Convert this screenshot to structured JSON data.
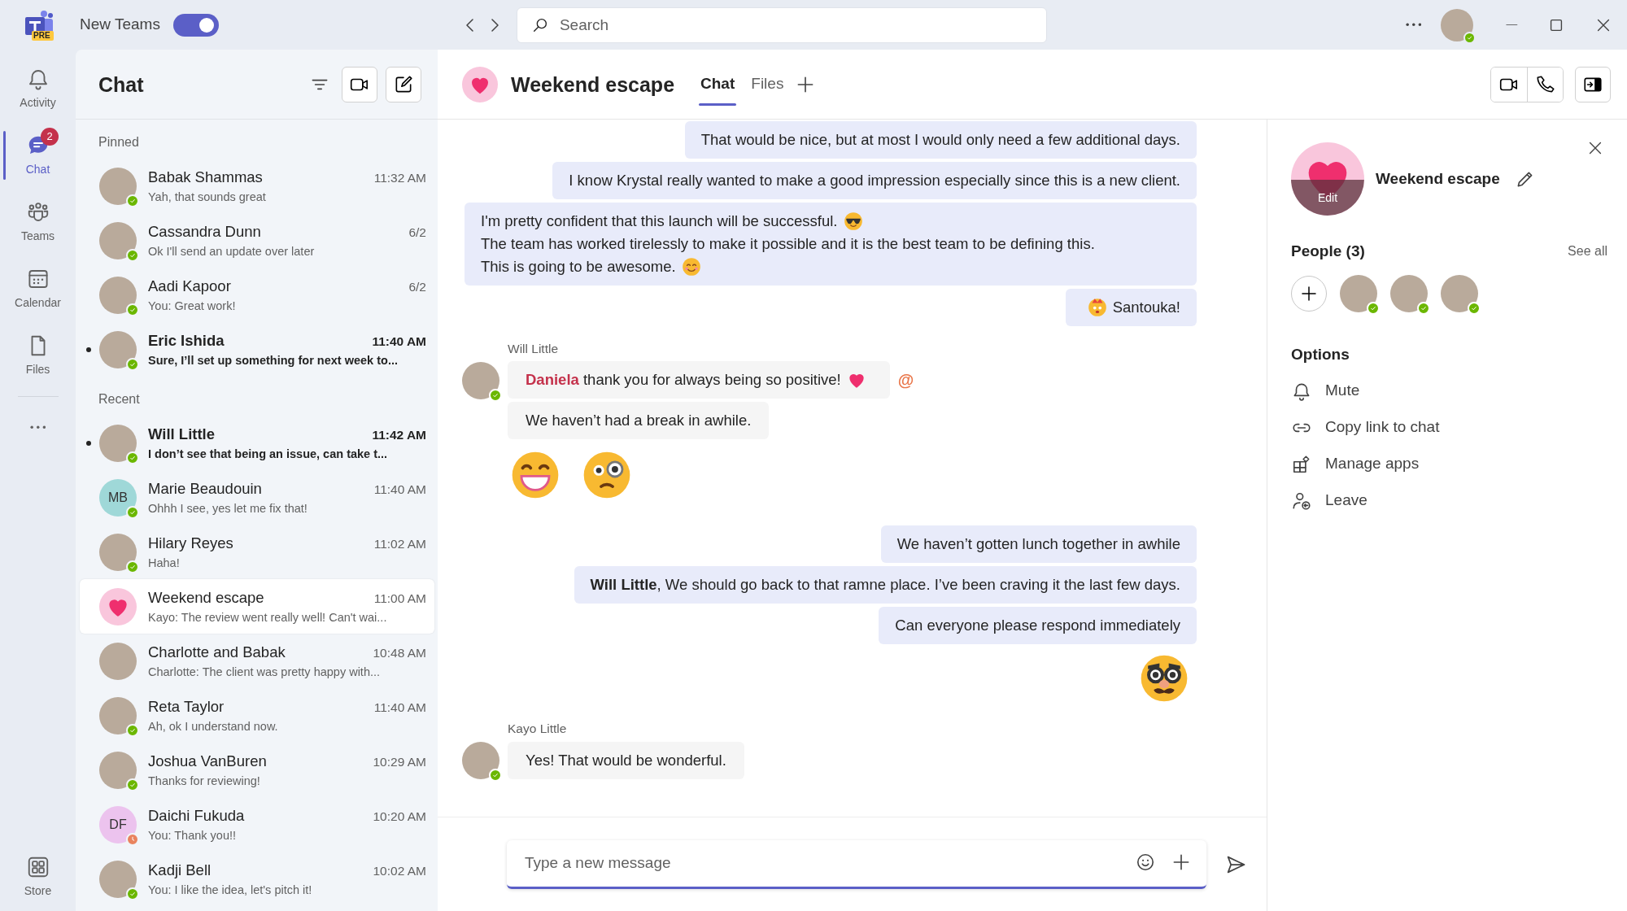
{
  "title_bar": {
    "logo_badge": "PRE",
    "toggle_label": "New Teams",
    "toggle_on": true,
    "search_placeholder": "Search"
  },
  "rail": {
    "items": [
      {
        "kind": "bell",
        "label": "Activity",
        "selected": false
      },
      {
        "kind": "chat",
        "label": "Chat",
        "badge": "2",
        "selected": true
      },
      {
        "kind": "teams",
        "label": "Teams",
        "selected": false
      },
      {
        "kind": "calendar",
        "label": "Calendar",
        "selected": false
      },
      {
        "kind": "files",
        "label": "Files",
        "selected": false
      }
    ],
    "store_label": "Store"
  },
  "chat_list": {
    "title": "Chat",
    "sections": [
      {
        "label": "Pinned",
        "items": [
          {
            "kind": "photo",
            "name": "Babak Shammas",
            "time": "11:32 AM",
            "preview": "Yah, that sounds great",
            "presence": {
              "kind": "available"
            },
            "unread": false,
            "selected": false
          },
          {
            "kind": "photo",
            "name": "Cassandra Dunn",
            "time": "6/2",
            "preview": "Ok I'll send an update over later",
            "presence": {
              "kind": "available"
            },
            "unread": false,
            "selected": false
          },
          {
            "kind": "photo",
            "name": "Aadi Kapoor",
            "time": "6/2",
            "preview": "You: Great work!",
            "presence": {
              "kind": "available"
            },
            "unread": false,
            "selected": false
          },
          {
            "kind": "photo",
            "name": "Eric Ishida",
            "time": "11:40 AM",
            "preview": "Sure, I’ll set up something for next week to...",
            "presence": {
              "kind": "available"
            },
            "unread": true,
            "selected": false
          }
        ]
      },
      {
        "label": "Recent",
        "items": [
          {
            "kind": "photo",
            "name": "Will Little",
            "time": "11:42 AM",
            "preview": "I don’t see that being an issue, can take t...",
            "presence": {
              "kind": "available"
            },
            "unread": true,
            "selected": false
          },
          {
            "kind": "initials",
            "initials": "MB",
            "color": "#9fd8d8",
            "name": "Marie Beaudouin",
            "time": "11:40 AM",
            "preview": "Ohhh I see, yes let me fix that!",
            "presence": {
              "kind": "available"
            },
            "unread": false,
            "selected": false
          },
          {
            "kind": "photo",
            "name": "Hilary Reyes",
            "time": "11:02 AM",
            "preview": "Haha!",
            "presence": {
              "kind": "available"
            },
            "unread": false,
            "selected": false
          },
          {
            "kind": "heart",
            "name": "Weekend escape",
            "time": "11:00 AM",
            "preview": "Kayo: The review went really well! Can't wai...",
            "unread": false,
            "selected": true
          },
          {
            "kind": "photo",
            "name": "Charlotte and Babak",
            "time": "10:48 AM",
            "preview": "Charlotte: The client was pretty happy with...",
            "unread": false,
            "selected": false
          },
          {
            "kind": "photo",
            "name": "Reta Taylor",
            "time": "11:40 AM",
            "preview": "Ah, ok I understand now.",
            "presence": {
              "kind": "available"
            },
            "unread": false,
            "selected": false
          },
          {
            "kind": "photo",
            "name": "Joshua VanBuren",
            "time": "10:29 AM",
            "preview": "Thanks for reviewing!",
            "presence": {
              "kind": "available"
            },
            "unread": false,
            "selected": false
          },
          {
            "kind": "initials",
            "initials": "DF",
            "color": "#ecc3ee",
            "name": "Daichi Fukuda",
            "time": "10:20 AM",
            "preview": "You: Thank you!!",
            "presence": {
              "kind": "away"
            },
            "unread": false,
            "selected": false
          },
          {
            "kind": "photo",
            "name": "Kadji Bell",
            "time": "10:02 AM",
            "preview": "You: I like the idea, let's pitch it!",
            "presence": {
              "kind": "available"
            },
            "unread": false,
            "selected": false
          }
        ]
      }
    ]
  },
  "conversation": {
    "title": "Weekend escape",
    "tabs": [
      {
        "label": "Chat",
        "selected": true
      },
      {
        "label": "Files",
        "selected": false
      }
    ],
    "messages": [
      {
        "kind": "sent",
        "segments": [
          {
            "kind": "text",
            "text": "That would be nice, but at most I would only need a few additional days."
          }
        ]
      },
      {
        "kind": "sent",
        "segments": [
          {
            "kind": "text",
            "text": "I know Krystal really wanted to make a good impression especially since this is a new client."
          }
        ]
      },
      {
        "kind": "sent",
        "segments": [
          {
            "kind": "text",
            "text": "I'm pretty confident that this launch will be successful."
          },
          {
            "kind": "cool"
          },
          {
            "kind": "text",
            "text": "The team has worked tirelessly to make it possible and it is the best team to be defining this."
          },
          {
            "kind": "text",
            "text": "This is going to be awesome."
          },
          {
            "kind": "smile"
          }
        ]
      },
      {
        "kind": "sent",
        "segments": [
          {
            "kind": "party"
          },
          {
            "kind": "text",
            "text": "Santouka!"
          }
        ]
      },
      {
        "kind": "received",
        "sender": "Will Little",
        "presence": {
          "kind": "available"
        },
        "bubbles": [
          {
            "segments": [
              {
                "kind": "text",
                "text": "**Daniela** thank you for always being so positive!"
              },
              {
                "kind": "heart"
              }
            ],
            "mention": "@"
          },
          {
            "segments": [
              {
                "kind": "text",
                "text": "We haven’t had a break in awhile."
              }
            ]
          }
        ],
        "stickers": [
          {
            "kind": "grin"
          },
          {
            "kind": "monocle"
          }
        ]
      },
      {
        "kind": "sent",
        "segments": [
          {
            "kind": "text",
            "text": "We haven’t gotten lunch together in awhile"
          }
        ]
      },
      {
        "kind": "sent",
        "segments": [
          {
            "kind": "text",
            "text": "**Will Little**, We should go back to that ramne place. I’ve been craving it the last few days."
          }
        ]
      },
      {
        "kind": "sent",
        "segments": [
          {
            "kind": "text",
            "text": "Can everyone please respond immediately"
          }
        ]
      },
      {
        "kind": "sent_sticker"
      },
      {
        "kind": "received",
        "sender": "Kayo Little",
        "presence": {
          "kind": "available"
        },
        "bubbles": [
          {
            "segments": [
              {
                "kind": "text",
                "text": "Yes! That would be wonderful."
              }
            ]
          }
        ]
      }
    ]
  },
  "composer": {
    "placeholder": "Type a new message"
  },
  "details_panel": {
    "avatar_overlay": "Edit",
    "title": "Weekend escape",
    "people_heading": "People (3)",
    "see_all": "See all",
    "people": [
      {
        "presence": {
          "kind": "available"
        }
      },
      {
        "presence": {
          "kind": "available"
        }
      },
      {
        "presence": {
          "kind": "available"
        }
      }
    ],
    "options_heading": "Options",
    "options": [
      {
        "kind": "mute",
        "label": "Mute"
      },
      {
        "kind": "link",
        "label": "Copy link to chat"
      },
      {
        "kind": "apps",
        "label": "Manage apps"
      },
      {
        "kind": "leave",
        "label": "Leave"
      }
    ]
  }
}
